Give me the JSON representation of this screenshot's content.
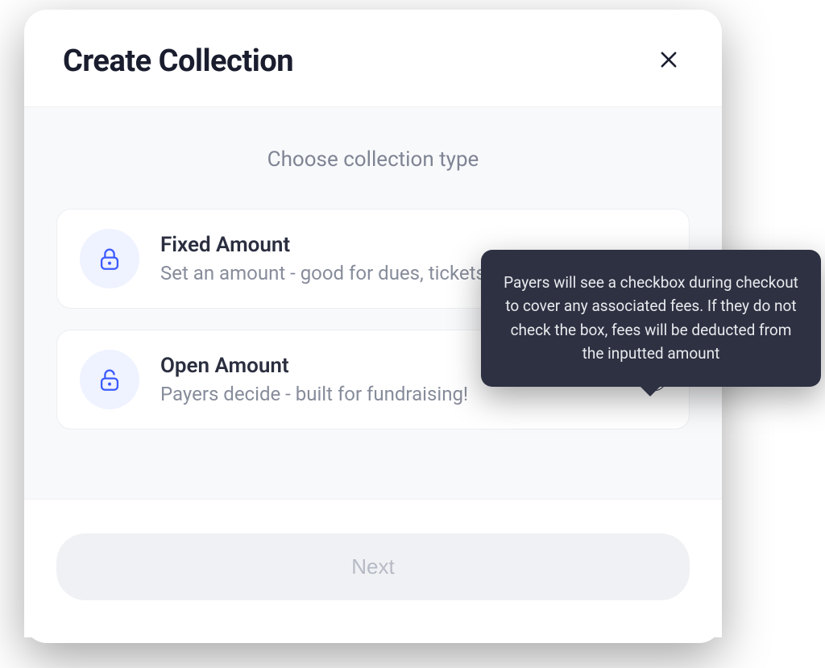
{
  "modal": {
    "title": "Create Collection",
    "body": {
      "section_title": "Choose collection type",
      "options": [
        {
          "title": "Fixed Amount",
          "description": "Set an amount - good for dues, tickets, and more"
        },
        {
          "title": "Open Amount",
          "description": "Payers decide - built for fundraising!"
        }
      ]
    },
    "footer": {
      "next_label": "Next"
    }
  },
  "tooltip": {
    "text": "Payers will see a checkbox during checkout to cover any associated fees. If they do not check the box, fees will be deducted from the inputted amount"
  },
  "colors": {
    "accent": "#3b5bff",
    "text_dark": "#1a1d2e",
    "text_muted": "#878c9b",
    "icon_bg": "#eff2ff",
    "tooltip_bg": "#2d3142"
  }
}
